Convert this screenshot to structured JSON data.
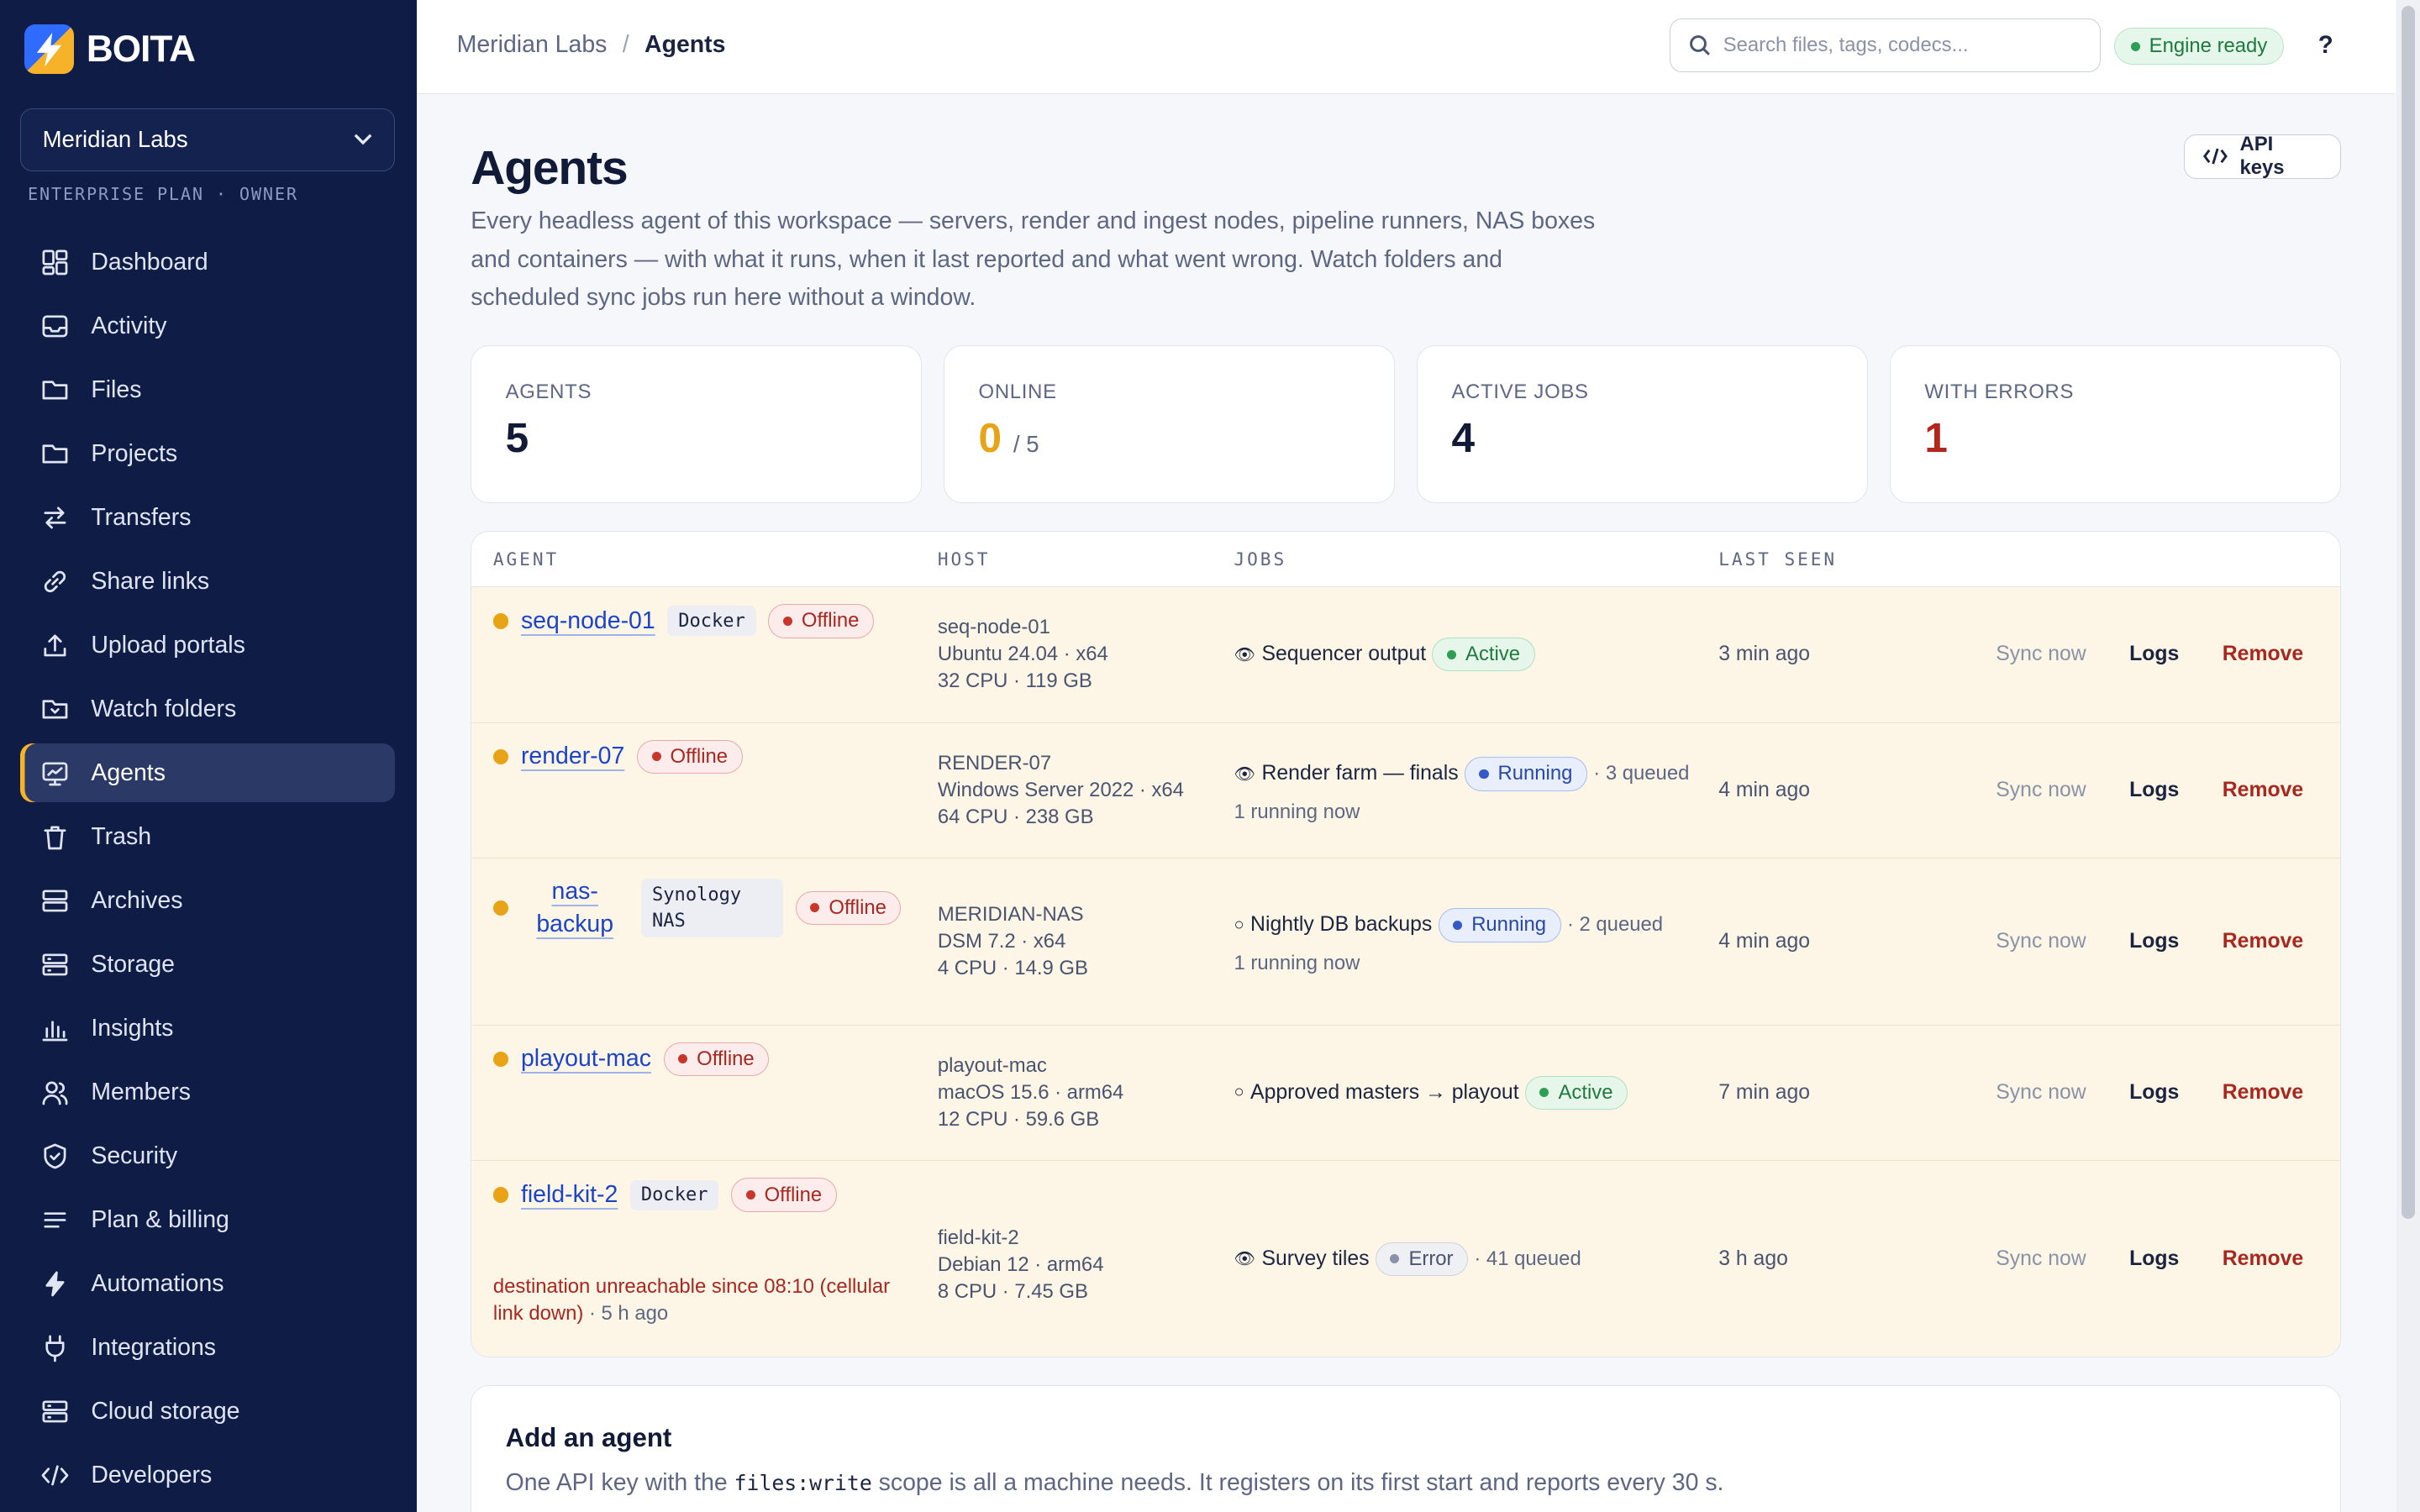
{
  "brand": {
    "name": "BOITA"
  },
  "workspace": {
    "name": "Meridian Labs",
    "meta": "ENTERPRISE PLAN · OWNER"
  },
  "sidebar": {
    "items": [
      {
        "label": "Dashboard",
        "icon": "dashboard-icon"
      },
      {
        "label": "Activity",
        "icon": "inbox-icon"
      },
      {
        "label": "Files",
        "icon": "folder-icon"
      },
      {
        "label": "Projects",
        "icon": "folder-icon"
      },
      {
        "label": "Transfers",
        "icon": "transfer-icon"
      },
      {
        "label": "Share links",
        "icon": "link-icon"
      },
      {
        "label": "Upload portals",
        "icon": "upload-icon"
      },
      {
        "label": "Watch folders",
        "icon": "watch-folder-icon"
      },
      {
        "label": "Agents",
        "icon": "monitor-icon",
        "active": true
      },
      {
        "label": "Trash",
        "icon": "trash-icon"
      },
      {
        "label": "Archives",
        "icon": "archive-icon"
      },
      {
        "label": "Storage",
        "icon": "storage-icon"
      },
      {
        "label": "Insights",
        "icon": "chart-icon"
      },
      {
        "label": "Members",
        "icon": "users-icon"
      },
      {
        "label": "Security",
        "icon": "shield-icon"
      },
      {
        "label": "Plan & billing",
        "icon": "list-icon"
      },
      {
        "label": "Automations",
        "icon": "bolt-icon"
      },
      {
        "label": "Integrations",
        "icon": "plug-icon"
      },
      {
        "label": "Cloud storage",
        "icon": "storage-icon"
      },
      {
        "label": "Developers",
        "icon": "code-icon"
      }
    ]
  },
  "header": {
    "breadcrumb": [
      "Meridian Labs",
      "Agents"
    ],
    "search_placeholder": "Search files, tags, codecs...",
    "engine_status": "Engine ready",
    "help": "?"
  },
  "page": {
    "title": "Agents",
    "description": "Every headless agent of this workspace — servers, render and ingest nodes, pipeline runners, NAS boxes and containers — with what it runs, when it last reported and what went wrong. Watch folders and scheduled sync jobs run here without a window.",
    "api_keys_label": "API keys"
  },
  "stats": [
    {
      "label": "AGENTS",
      "value": "5",
      "color": "#111a36"
    },
    {
      "label": "ONLINE",
      "value": "0",
      "suffix": "/ 5",
      "color": "#e8a317"
    },
    {
      "label": "ACTIVE JOBS",
      "value": "4",
      "color": "#111a36"
    },
    {
      "label": "WITH ERRORS",
      "value": "1",
      "color": "#b3261e"
    }
  ],
  "table": {
    "columns": [
      "AGENT",
      "HOST",
      "JOBS",
      "LAST SEEN"
    ],
    "actions": {
      "sync": "Sync now",
      "logs": "Logs",
      "remove": "Remove"
    },
    "rows": [
      {
        "name": "seq-node-01",
        "tag": "Docker",
        "status": "Offline",
        "host": [
          "seq-node-01",
          "Ubuntu 24.04 · x64",
          "32 CPU · 119 GB"
        ],
        "job_icon": "👁",
        "job": "Sequencer output",
        "job_status": "Active",
        "queued": "",
        "running": "",
        "seen": "3 min ago"
      },
      {
        "name": "render-07",
        "tag": "",
        "status": "Offline",
        "host": [
          "RENDER-07",
          "Windows Server 2022 · x64",
          "64 CPU · 238 GB"
        ],
        "job_icon": "👁",
        "job": "Render farm — finals",
        "job_status": "Running",
        "queued": "· 3 queued",
        "running": "1 running now",
        "seen": "4 min ago"
      },
      {
        "name": "nas-backup",
        "tag": "Synology NAS",
        "status": "Offline",
        "host": [
          "MERIDIAN-NAS",
          "DSM 7.2 · x64",
          "4 CPU · 14.9 GB"
        ],
        "job_icon": "○",
        "job": "Nightly DB backups",
        "job_status": "Running",
        "queued": "· 2 queued",
        "running": "1 running now",
        "seen": "4 min ago"
      },
      {
        "name": "playout-mac",
        "tag": "",
        "status": "Offline",
        "host": [
          "playout-mac",
          "macOS 15.6 · arm64",
          "12 CPU · 59.6 GB"
        ],
        "job_icon": "○",
        "job": "Approved masters → playout",
        "job_status": "Active",
        "queued": "",
        "running": "",
        "seen": "7 min ago"
      },
      {
        "name": "field-kit-2",
        "tag": "Docker",
        "status": "Offline",
        "host": [
          "field-kit-2",
          "Debian 12 · arm64",
          "8 CPU · 7.45 GB"
        ],
        "job_icon": "👁",
        "job": "Survey tiles",
        "job_status": "Error",
        "queued": "· 41 queued",
        "running": "",
        "seen": "3 h ago",
        "error": "destination unreachable since 08:10 (cellular link down)",
        "error_time": "· 5 h ago"
      }
    ]
  },
  "add_agent": {
    "title": "Add an agent",
    "text_before": "One API key with the ",
    "scope": "files:write",
    "text_after": " scope is all a machine needs. It registers on its first start and reports every 30 s."
  }
}
